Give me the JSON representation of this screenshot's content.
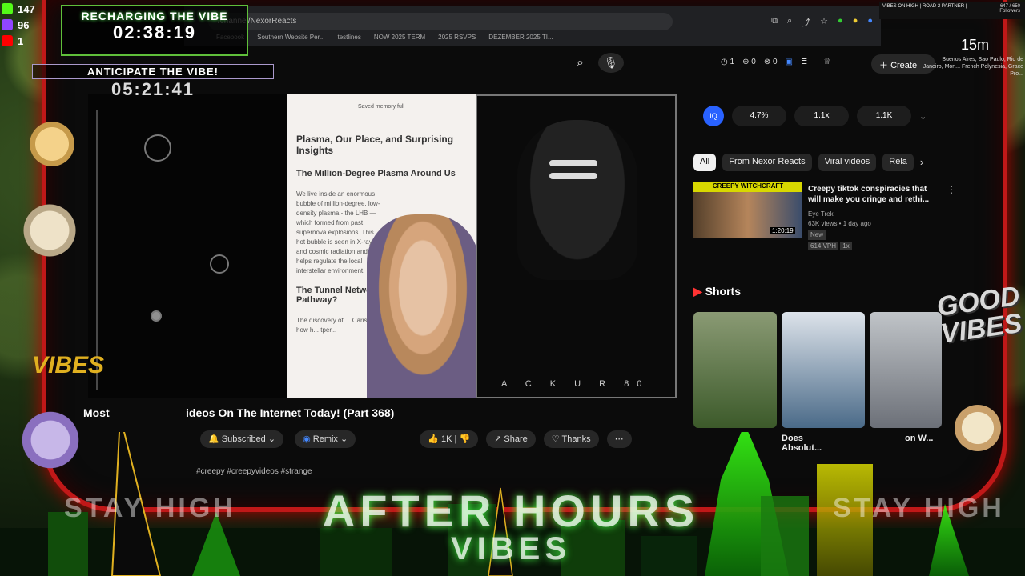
{
  "overlay": {
    "counters": {
      "kick": "147",
      "twitch": "96",
      "youtube": "1"
    },
    "recharging": {
      "title": "RECHARGING THE VIBE",
      "time": "02:38:19"
    },
    "anticipate": {
      "title": "ANTICIPATE THE VIBE!",
      "time": "05:21:41"
    },
    "top_right_title": "VIBES ON HIGH | ROAD 2 PARTNER |",
    "followers_count": "647 / 650",
    "followers_label": "Followers",
    "time_elapsed": "15m",
    "location": "Buenos Aires, Sao Paulo, Rio de Janeiro, Mon... French Polynesia, Grace Pro...",
    "good_vibes": "GOOD VIBES",
    "vibes_left": "VIBES",
    "stay_high_left": "STAY HIGH",
    "stay_high_right": "STAY HIGH",
    "after_hours": "AFTER HOURS",
    "after_hours_line2": "VIBES"
  },
  "browser": {
    "url": "/channel/NexorReacts",
    "bookmarks": [
      "Facebook",
      "Southern Website Per...",
      "testlines",
      "NOW 2025 TERM",
      "2025 RSVPS",
      "DEZEMBER 2025 TI..."
    ]
  },
  "youtube": {
    "stats": [
      "1",
      "0",
      "0"
    ],
    "create_label": "Create",
    "video": {
      "doc_saved": "Saved memory full",
      "doc_title": "Plasma, Our Place, and Surprising Insights",
      "doc_h2": "The Million-Degree Plasma Around Us",
      "doc_body": "We live inside an enormous bubble of million-degree, low-density plasma - the LHB —which formed from past supernova explosions. This hot bubble is seen in X-ray and cosmic radiation and helps regulate the local interstellar environment.",
      "doc_h3": "The Tunnel Network Pathway?",
      "doc_body2": "The discovery of ... CarisMa ... how h... tper...",
      "mask_bar": "A C K U R",
      "mask_number": "80"
    },
    "title_prefix": "Most",
    "title": "ideos On The Internet Today! (Part 368)",
    "actions": {
      "subscribed": "Subscribed",
      "remix": "Remix",
      "likes": "1K",
      "share": "Share",
      "thanks": "Thanks"
    },
    "hashtags": "#creepy #creepyvideos #strange",
    "metrics": [
      "4.7%",
      "1.1x",
      "1.1K"
    ],
    "chips": [
      "All",
      "From Nexor Reacts",
      "Viral videos",
      "Rela"
    ],
    "recommended": {
      "thumb_label": "CREEPY WITCHCRAFT",
      "duration": "1:20:19",
      "title": "Creepy tiktok conspiracies that will make you cringe and rethi...",
      "channel": "Eye Trek",
      "views": "63K views • 1 day ago",
      "badge": "New",
      "vph": "614 VPH",
      "ratio": "1x"
    },
    "shorts_label": "Shorts",
    "shorts_captions": [
      "Does Absolut...",
      "on W..."
    ]
  },
  "colors": {
    "frame_red": "#c01818",
    "timer_green": "#5fbf3a",
    "youtube_blue": "#2962ff",
    "city_green": "#39ff14"
  }
}
